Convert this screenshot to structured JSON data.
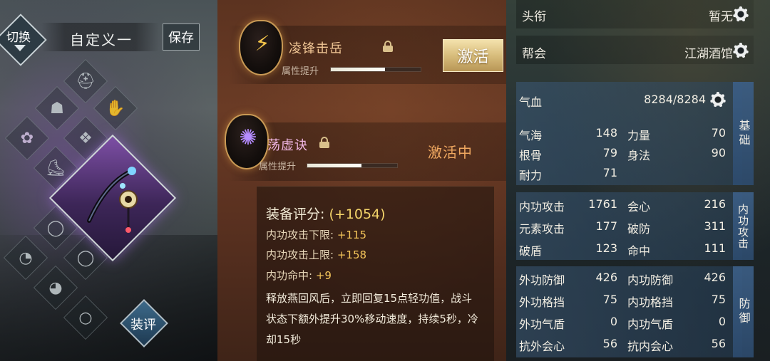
{
  "left_panel": {
    "switch_label": "切换",
    "preset_name": "自定义一",
    "save_label": "保存",
    "review_label": "装评",
    "equipment_slots": [
      {
        "icon": "helmet-icon"
      },
      {
        "icon": "cloak-icon"
      },
      {
        "icon": "gauntlet-icon"
      },
      {
        "icon": "bow-icon"
      },
      {
        "icon": "armor-icon"
      },
      {
        "icon": "boots-icon"
      },
      {
        "icon": "ring-icon"
      },
      {
        "icon": "ring-icon"
      },
      {
        "icon": "pendant-icon"
      },
      {
        "icon": "bracelet-icon"
      },
      {
        "icon": "badge-icon"
      },
      {
        "icon": "talisman-icon"
      }
    ],
    "selected_item": "fan-weapon"
  },
  "middle_panel": {
    "skills": [
      {
        "name": "凌锋击岳",
        "prop_label": "属性提升",
        "progress": 0.6,
        "action": "激活",
        "locked": true
      },
      {
        "name": "荡虚诀",
        "prop_label": "属性提升",
        "progress": 0.6,
        "action": "激活中",
        "locked": true
      }
    ],
    "tooltip": {
      "score_label": "装备评分:",
      "score_bonus": "(+1054)",
      "lines": [
        {
          "label": "内功攻击下限:",
          "value": "+115"
        },
        {
          "label": "内功攻击上限:",
          "value": "+158"
        },
        {
          "label": "内功命中:",
          "value": "+9"
        }
      ],
      "description": "释放燕回风后，立即回复15点轻功值，战斗状态下额外提升30%移动速度，持续5秒，冷却15秒"
    }
  },
  "right_panel": {
    "title_row": {
      "label": "头衔",
      "value": "暂无"
    },
    "guild_row": {
      "label": "帮会",
      "value": "江湖酒馆"
    },
    "hp": {
      "label": "气血",
      "value": "8284/8284"
    },
    "basic": {
      "tag": "基础",
      "stats": [
        {
          "label": "气海",
          "value": "148"
        },
        {
          "label": "力量",
          "value": "70"
        },
        {
          "label": "根骨",
          "value": "79"
        },
        {
          "label": "身法",
          "value": "90"
        },
        {
          "label": "耐力",
          "value": "71"
        }
      ]
    },
    "inner_attack": {
      "tag": "内功攻击",
      "stats": [
        {
          "label": "内功攻击",
          "value": "1761"
        },
        {
          "label": "会心",
          "value": "216"
        },
        {
          "label": "元素攻击",
          "value": "177"
        },
        {
          "label": "破防",
          "value": "311"
        },
        {
          "label": "破盾",
          "value": "123"
        },
        {
          "label": "命中",
          "value": "111"
        }
      ]
    },
    "defense": {
      "tag": "防御",
      "stats": [
        {
          "label": "外功防御",
          "value": "426"
        },
        {
          "label": "内功防御",
          "value": "426"
        },
        {
          "label": "外功格挡",
          "value": "75"
        },
        {
          "label": "内功格挡",
          "value": "75"
        },
        {
          "label": "外功气盾",
          "value": "0"
        },
        {
          "label": "内功气盾",
          "value": "0"
        },
        {
          "label": "抗外会心",
          "value": "56"
        },
        {
          "label": "抗内会心",
          "value": "56"
        }
      ]
    }
  }
}
